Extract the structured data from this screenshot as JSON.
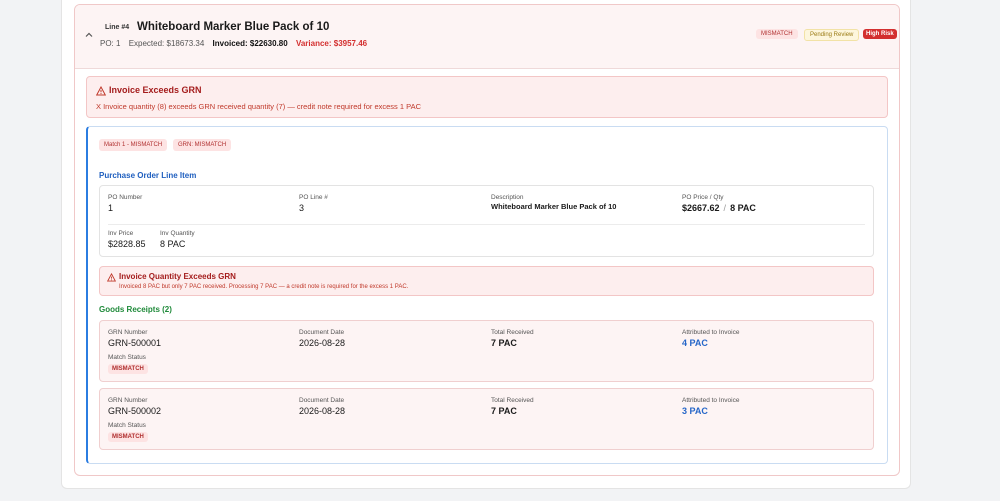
{
  "line": {
    "tag": "Line #4",
    "title": "Whiteboard Marker Blue Pack of 10",
    "po": "PO: 1",
    "expected": "Expected: $18673.34",
    "invoiced": "Invoiced: $22630.80",
    "variance": "Variance: $3957.46",
    "badges": {
      "mismatch": "MISMATCH",
      "pending": "Pending Review",
      "risk": "High Risk"
    }
  },
  "alert": {
    "title": "Invoice Exceeds GRN",
    "text": "X Invoice quantity (8) exceeds GRN received quantity (7) — credit note required for excess 1 PAC"
  },
  "match": {
    "badge1": "Match 1 - MISMATCH",
    "badge2": "GRN: MISMATCH",
    "po_section_title": "Purchase Order Line Item",
    "po": {
      "po_number_label": "PO Number",
      "po_number": "1",
      "po_line_label": "PO Line #",
      "po_line": "3",
      "description_label": "Description",
      "description": "Whiteboard Marker Blue Pack of 10",
      "price_qty_label": "PO Price / Qty",
      "price": "$2667.62",
      "sep": "/",
      "qty": "8 PAC",
      "inv_price_label": "Inv Price",
      "inv_price": "$2828.85",
      "inv_qty_label": "Inv Quantity",
      "inv_qty": "8 PAC"
    },
    "alert": {
      "title": "Invoice Quantity Exceeds GRN",
      "text": "Invoiced 8 PAC but only 7 PAC received. Processing 7 PAC — a credit note is required for the excess 1 PAC."
    },
    "gr_section_title": "Goods Receipts (2)",
    "receipts": [
      {
        "grn_label": "GRN Number",
        "grn": "GRN-500001",
        "date_label": "Document Date",
        "date": "2026-08-28",
        "received_label": "Total Received",
        "received": "7 PAC",
        "attributed_label": "Attributed to Invoice",
        "attributed": "4 PAC",
        "status_label": "Match Status",
        "status": "MISMATCH"
      },
      {
        "grn_label": "GRN Number",
        "grn": "GRN-500002",
        "date_label": "Document Date",
        "date": "2026-08-28",
        "received_label": "Total Received",
        "received": "7 PAC",
        "attributed_label": "Attributed to Invoice",
        "attributed": "3 PAC",
        "status_label": "Match Status",
        "status": "MISMATCH"
      }
    ]
  },
  "colors": {
    "accent": "#2b7de1",
    "danger": "#d32f2f",
    "success": "#1f8a3a"
  }
}
